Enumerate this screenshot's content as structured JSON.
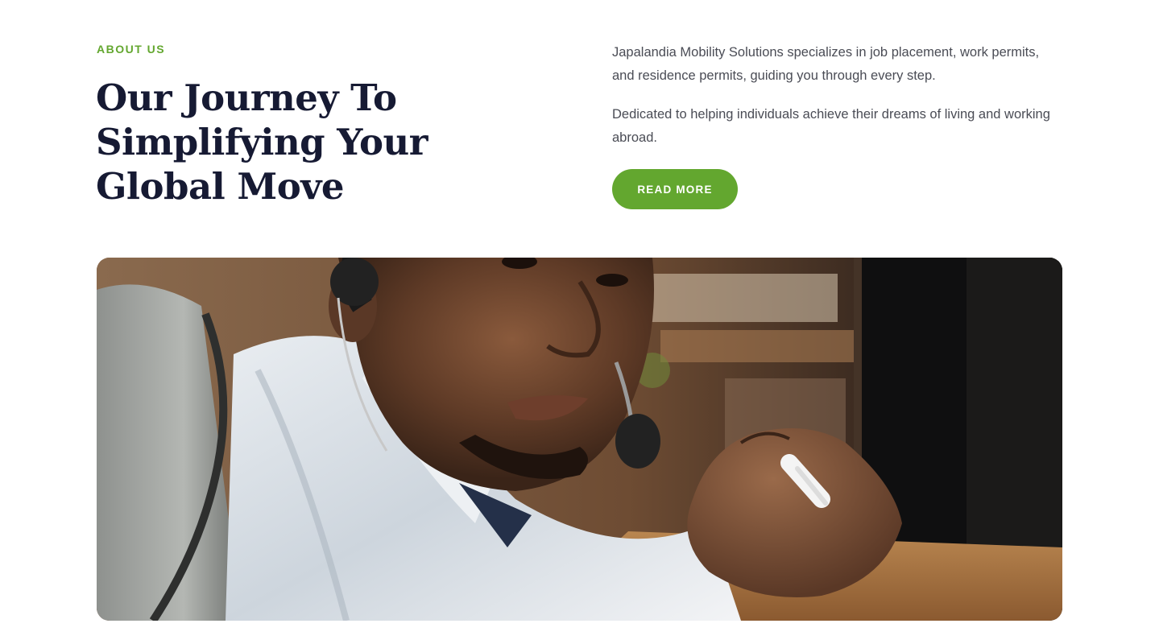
{
  "about": {
    "eyebrow": "ABOUT US",
    "headline": "Our Journey To Simplifying Your Global Move",
    "paragraphs": [
      "Japalandia Mobility Solutions specializes in job placement, work permits, and residence permits, guiding you through every step.",
      "Dedicated to helping individuals achieve their dreams of living and working abroad."
    ],
    "cta_label": "READ MORE"
  },
  "image": {
    "subject": "man-with-headset-holding-pen"
  },
  "colors": {
    "accent": "#63a72f",
    "heading": "#161a33",
    "body_text": "#4a4c55",
    "background": "#ffffff"
  }
}
